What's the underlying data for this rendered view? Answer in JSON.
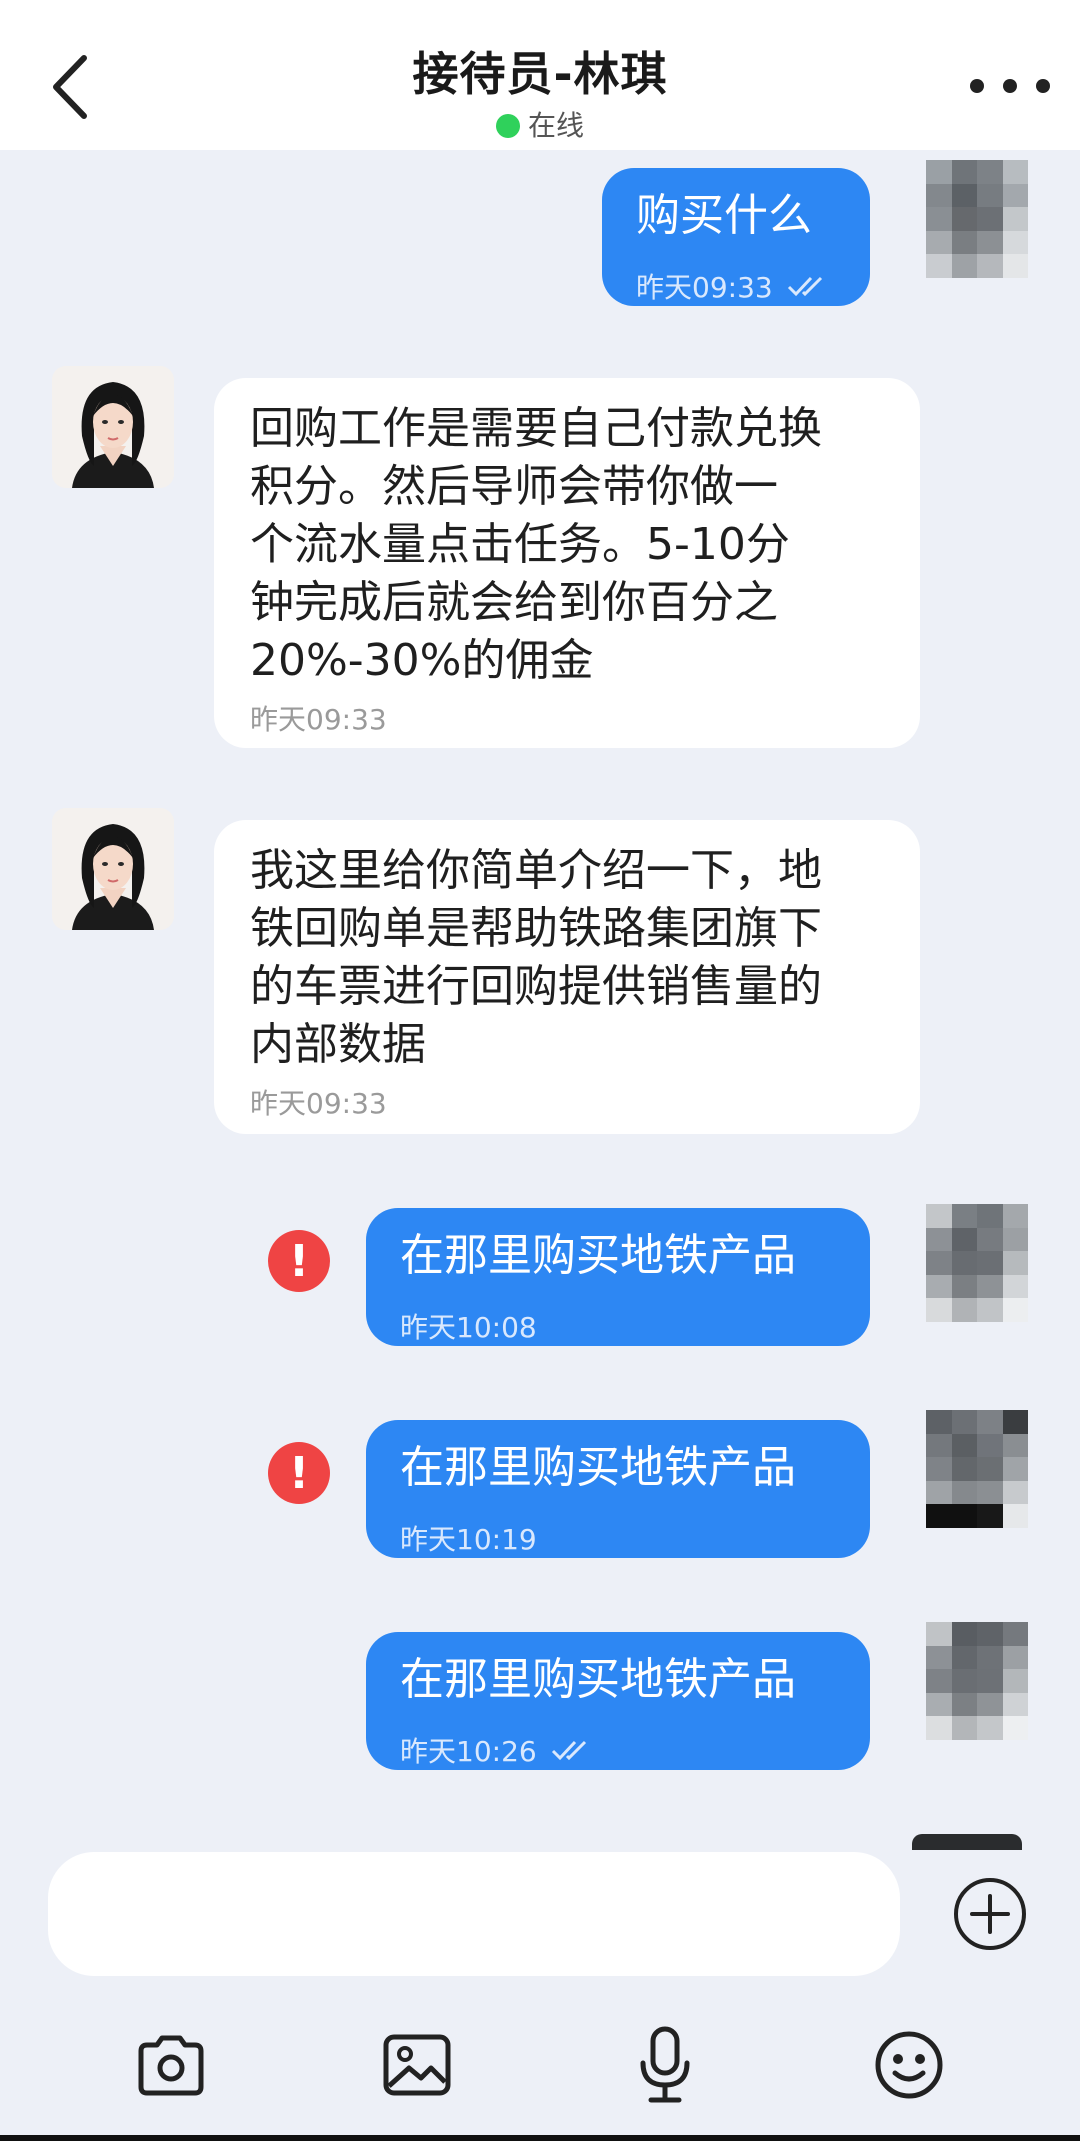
{
  "header": {
    "title": "接待员-林琪",
    "status": "在线",
    "back_icon": "chevron-left-icon",
    "more_icon": "more-horizontal-icon"
  },
  "messages": [
    {
      "side": "out",
      "text": "购买什么",
      "time": "昨天09:33",
      "read": true,
      "failed": false
    },
    {
      "side": "in",
      "text": "回购工作是需要自己付款兑换积分。然后导师会带你做一个流水量点击任务。5-10分钟完成后就会给到你百分之20%-30%的佣金",
      "time": "昨天09:33"
    },
    {
      "side": "in",
      "text": "我这里给你简单介绍一下，地铁回购单是帮助铁路集团旗下的车票进行回购提供销售量的内部数据",
      "time": "昨天09:33"
    },
    {
      "side": "out",
      "text": "在那里购买地铁产品",
      "time": "昨天10:08",
      "read": false,
      "failed": true
    },
    {
      "side": "out",
      "text": "在那里购买地铁产品",
      "time": "昨天10:19",
      "read": false,
      "failed": true
    },
    {
      "side": "out",
      "text": "在那里购买地铁产品",
      "time": "昨天10:26",
      "read": true,
      "failed": false
    }
  ],
  "in_lines": {
    "m1": [
      "回购工作是需要自己付款兑换",
      "积分。然后导师会带你做一",
      "个流水量点击任务。5-10分",
      "钟完成后就会给到你百分之",
      "20%-30%的佣金"
    ],
    "m2": [
      "我这里给你简单介绍一下，地",
      "铁回购单是帮助铁路集团旗下",
      "的车票进行回购提供销售量的",
      "内部数据"
    ]
  },
  "composer": {
    "placeholder": "",
    "plus_icon": "plus-circle-icon"
  },
  "toolbar": [
    "camera-icon",
    "image-icon",
    "microphone-icon",
    "emoji-icon"
  ],
  "colors": {
    "outgoing_bubble": "#2d87f3",
    "incoming_bubble": "#ffffff",
    "background": "#edf0f7",
    "online": "#2fd15b",
    "error": "#ef4444"
  }
}
